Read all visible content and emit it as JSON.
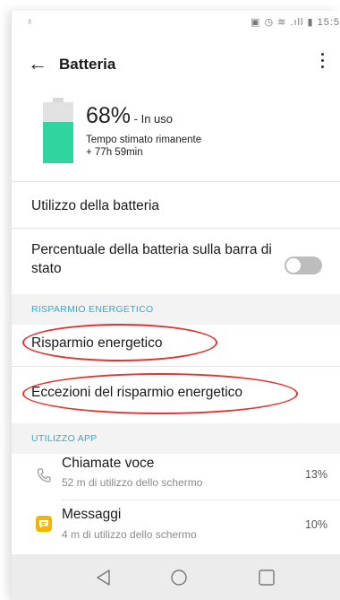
{
  "status_bar": {
    "left": "♁",
    "right": "▣ ◷ ≋ .ıll ▮ 15:5"
  },
  "app_bar": {
    "title": "Batteria"
  },
  "battery": {
    "percent": "68%",
    "state": " - In uso",
    "level": 0.68,
    "fill_color": "#2fd4a0",
    "estimate_label": "Tempo stimato rimanente",
    "estimate_value": "+ 77h 59min"
  },
  "settings": {
    "usage": "Utilizzo della batteria",
    "percent_bar_line1": "Percentuale della batteria sulla barra di",
    "percent_bar_line2": "stato",
    "percent_bar_toggle_on": false
  },
  "sections": {
    "power_saving": "RISPARMIO ENERGETICO",
    "app_usage": "UTILIZZO APP"
  },
  "power_saving": {
    "item1": "Risparmio energetico",
    "item2": "Eccezioni del risparmio energetico"
  },
  "apps": [
    {
      "name": "Chiamate voce",
      "sub": "52 m di utilizzo dello schermo",
      "pct": "13%",
      "icon": "phone-icon"
    },
    {
      "name": "Messaggi",
      "sub": "4 m di utilizzo dello schermo",
      "pct": "10%",
      "icon": "message-icon"
    }
  ],
  "colors": {
    "accent": "#3aa6c9",
    "annotation": "#e3342f",
    "message_icon": "#f5b400"
  }
}
